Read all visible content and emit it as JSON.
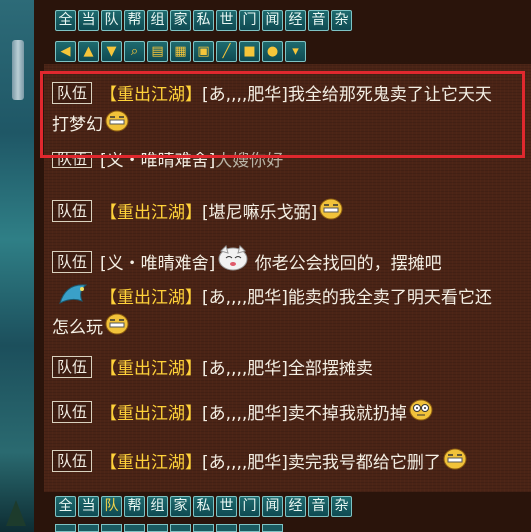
{
  "channel_tabs": [
    "全",
    "当",
    "队",
    "帮",
    "组",
    "家",
    "私",
    "世",
    "门",
    "闻",
    "经",
    "音",
    "杂"
  ],
  "bottom_active_tab_index": 2,
  "toolbar_icons": [
    "arrow-left-icon",
    "arrow-up-icon",
    "arrow-down-icon",
    "magnifier-icon",
    "note-icon",
    "grid-icon",
    "lock-icon",
    "broom-icon",
    "folder-icon",
    "speech-bubble-icon",
    "chevron-down-icon"
  ],
  "messages": [
    {
      "channel": "队伍",
      "guild": "【重出江湖】",
      "sender": "[あ,,,,肥华]",
      "text": "我全给那死鬼卖了让它天天",
      "text2": "打梦幻",
      "emote": "grin"
    },
    {
      "channel": "队伍",
      "guild": "",
      "sender": "[义・唯晴难舍]",
      "text": "大嫂你好",
      "emote": ""
    },
    {
      "channel": "队伍",
      "guild": "【重出江湖】",
      "sender": "[堪尼嘛乐戈弼]",
      "text": "",
      "emote": "grin"
    },
    {
      "channel": "队伍",
      "guild": "",
      "sender": "[义・唯晴难舍]",
      "text": "你老公会找回的，摆摊吧",
      "emote": "cat"
    },
    {
      "channel": "队伍",
      "guild": "【重出江湖】",
      "sender": "[あ,,,,肥华]",
      "text": "能卖的我全卖了明天看它还",
      "text2": "怎么玩",
      "emote": "grin",
      "avatar": "bird"
    },
    {
      "channel": "队伍",
      "guild": "【重出江湖】",
      "sender": "[あ,,,,肥华]",
      "text": "全部摆摊卖",
      "emote": ""
    },
    {
      "channel": "队伍",
      "guild": "【重出江湖】",
      "sender": "[あ,,,,肥华]",
      "text": "卖不掉我就扔掉",
      "emote": "dizzy"
    },
    {
      "channel": "队伍",
      "guild": "【重出江湖】",
      "sender": "[あ,,,,肥华]",
      "text": "卖完我号都给它删了",
      "emote": "grin"
    }
  ],
  "colors": {
    "guild": "#ffd23a",
    "highlight": "#e0282e",
    "tab_bg": "#1e6a6e",
    "chat_bg": "#4a2416"
  }
}
